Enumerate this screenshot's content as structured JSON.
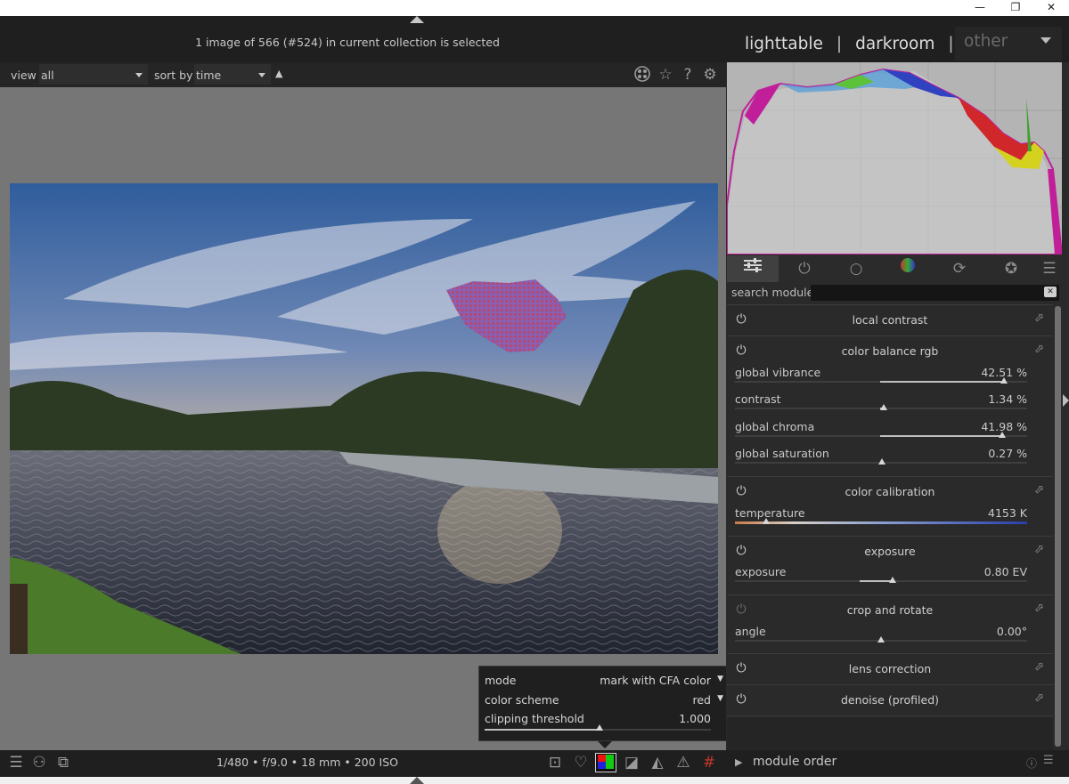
{
  "window": {
    "minimize": "—",
    "restore": "❐",
    "close": "✕"
  },
  "header": {
    "status": "1 image of 566 (#524) in current collection is selected",
    "views": [
      "lighttable",
      "darkroom",
      "other"
    ],
    "separator": "|"
  },
  "filterbar": {
    "view_label": "view",
    "view_value": "all",
    "sort_label": "sort by",
    "sort_value": "time",
    "sort_direction": "▲"
  },
  "top_icons": [
    "grouping-icon",
    "star-icon",
    "help-icon",
    "gear-icon"
  ],
  "clipping_popup": {
    "mode_label": "mode",
    "mode_value": "mark with CFA color",
    "scheme_label": "color scheme",
    "scheme_value": "red",
    "threshold_label": "clipping threshold",
    "threshold_value": "1.000",
    "dropdown_glyph": "▼"
  },
  "bottombar": {
    "exif": "1/480 • f/9.0 • 18 mm • 200 ISO",
    "module_order": "module order"
  },
  "right_panel": {
    "search_label": "search module",
    "modules": [
      {
        "name": "local contrast",
        "enabled": true,
        "sliders": []
      },
      {
        "name": "color balance rgb",
        "enabled": true,
        "sliders": [
          {
            "label": "global vibrance",
            "value": "42.51 %"
          },
          {
            "label": "contrast",
            "value": "1.34 %"
          },
          {
            "label": "global chroma",
            "value": "41.98 %"
          },
          {
            "label": "global saturation",
            "value": "0.27 %"
          }
        ]
      },
      {
        "name": "color calibration",
        "enabled": true,
        "sliders": [
          {
            "label": "temperature",
            "value": "4153 K"
          }
        ]
      },
      {
        "name": "exposure",
        "enabled": true,
        "sliders": [
          {
            "label": "exposure",
            "value": "0.80 EV"
          }
        ]
      },
      {
        "name": "crop and rotate",
        "enabled": false,
        "sliders": [
          {
            "label": "angle",
            "value": "0.00°"
          }
        ]
      },
      {
        "name": "lens correction",
        "enabled": true,
        "sliders": []
      },
      {
        "name": "denoise (profiled)",
        "enabled": true,
        "sliders": []
      }
    ]
  },
  "colors": {
    "accent": "#bfbfbf",
    "panel": "#2a2a2a",
    "center_bg": "#767676"
  }
}
